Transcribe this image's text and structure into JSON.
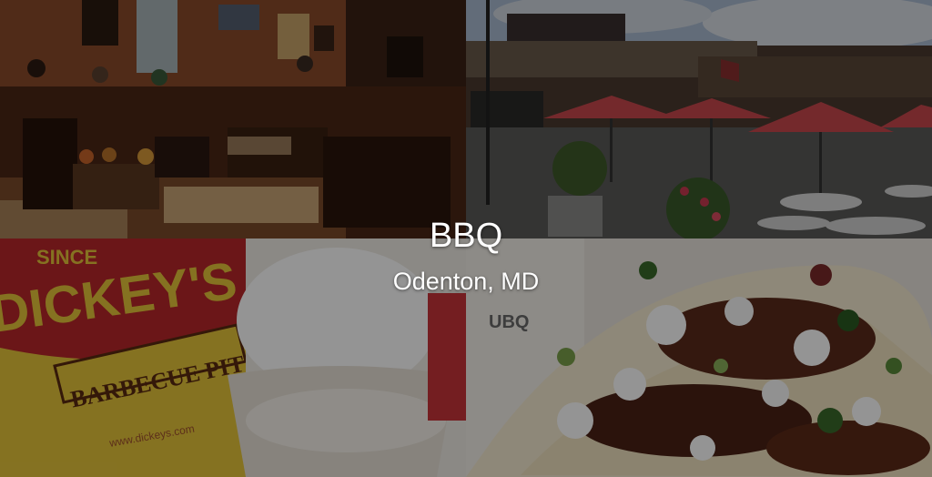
{
  "hero": {
    "title": "BBQ",
    "subtitle": "Odenton, MD"
  },
  "photos": [
    {
      "name": "restaurant-interior-photo"
    },
    {
      "name": "outdoor-patio-photo"
    },
    {
      "name": "dickeys-cup-photo",
      "printed_text": [
        "SINCE",
        "DICKEY'S",
        "BARBECUE PIT",
        "www.dickeys.com"
      ]
    },
    {
      "name": "bbq-tacos-photo",
      "printed_text": [
        "UBQ"
      ]
    }
  ],
  "colors": {
    "overlay": "#000000",
    "caption_text": "#ffffff",
    "umbrella_red": "#c8474d",
    "cup_red": "#b8262a",
    "cup_yellow": "#e6c53a"
  }
}
